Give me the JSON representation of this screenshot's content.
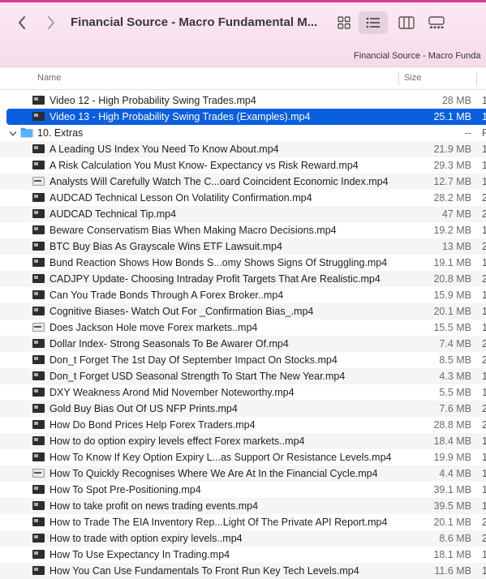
{
  "window": {
    "title": "Financial Source - Macro Fundamental M...",
    "path": "Financial Source - Macro Funda"
  },
  "columns": {
    "name": "Name",
    "size": "Size"
  },
  "top_rows": [
    {
      "name": "Video 12 - High Probability Swing Trades.mp4",
      "size": "28 MB",
      "extra": "1",
      "icon": "video-thumbnail-icon"
    },
    {
      "name": "Video 13 - High Probability Swing Trades (Examples).mp4",
      "size": "25.1 MB",
      "extra": "1",
      "icon": "video-thumbnail-icon",
      "selected": true
    }
  ],
  "folder": {
    "name": "10. Extras",
    "size": "--",
    "extra": "F"
  },
  "files": [
    {
      "name": "A Leading US Index You Need To Know About.mp4",
      "size": "21.9 MB",
      "extra": "1"
    },
    {
      "name": "A Risk Calculation You Must Know- Expectancy vs Risk Reward.mp4",
      "size": "29.3 MB",
      "extra": "1"
    },
    {
      "name": "Analysts Will Carefully Watch The C...oard Coincident Economic Index.mp4",
      "size": "12.7 MB",
      "extra": "1",
      "light": true
    },
    {
      "name": "AUDCAD Technical Lesson On Volatility Confirmation.mp4",
      "size": "28.2 MB",
      "extra": "2"
    },
    {
      "name": "AUDCAD Technical Tip.mp4",
      "size": "47 MB",
      "extra": "2"
    },
    {
      "name": "Beware Conservatism Bias When Making Macro Decisions.mp4",
      "size": "19.2 MB",
      "extra": "1"
    },
    {
      "name": "BTC Buy Bias As Grayscale Wins ETF Lawsuit.mp4",
      "size": "13 MB",
      "extra": "2"
    },
    {
      "name": "Bund Reaction Shows How Bonds S...omy Shows Signs Of Struggling.mp4",
      "size": "19.1 MB",
      "extra": "1"
    },
    {
      "name": "CADJPY Update- Choosing Intraday Profit Targets That Are Realistic.mp4",
      "size": "20.8 MB",
      "extra": "2"
    },
    {
      "name": "Can You Trade Bonds Through A Forex Broker..mp4",
      "size": "15.9 MB",
      "extra": "1"
    },
    {
      "name": "Cognitive Biases- Watch Out For _Confirmation Bias_.mp4",
      "size": "20.1 MB",
      "extra": "1"
    },
    {
      "name": "Does Jackson Hole move Forex markets..mp4",
      "size": "15.5 MB",
      "extra": "1",
      "light": true
    },
    {
      "name": "Dollar Index- Strong Seasonals To Be Awarer Of.mp4",
      "size": "7.4 MB",
      "extra": "2"
    },
    {
      "name": "Don_t Forget The 1st Day Of September Impact On Stocks.mp4",
      "size": "8.5 MB",
      "extra": "2"
    },
    {
      "name": "Don_t Forget USD Seasonal Strength To Start The New Year.mp4",
      "size": "4.3 MB",
      "extra": "1"
    },
    {
      "name": "DXY Weakness Arond Mid November Noteworthy.mp4",
      "size": "5.5 MB",
      "extra": "1"
    },
    {
      "name": "Gold Buy Bias Out Of US NFP Prints.mp4",
      "size": "7.6 MB",
      "extra": "2"
    },
    {
      "name": "How Do Bond Prices Help Forex Traders.mp4",
      "size": "28.8 MB",
      "extra": "2"
    },
    {
      "name": "How to do option expiry levels effect Forex markets..mp4",
      "size": "18.4 MB",
      "extra": "1"
    },
    {
      "name": "How To Know If Key Option Expiry L...as Support Or Resistance Levels.mp4",
      "size": "19.9 MB",
      "extra": "1"
    },
    {
      "name": "How To Quickly Recognises Where We Are At In the Financial Cycle.mp4",
      "size": "4.4 MB",
      "extra": "1",
      "light": true
    },
    {
      "name": "How To Spot Pre-Positioning.mp4",
      "size": "39.1 MB",
      "extra": "1"
    },
    {
      "name": "How to take profit on news trading events.mp4",
      "size": "39.5 MB",
      "extra": "1"
    },
    {
      "name": "How to Trade The EIA Inventory Rep...Light Of The Private API Report.mp4",
      "size": "20.1 MB",
      "extra": "2"
    },
    {
      "name": "How to trade with option expiry levels..mp4",
      "size": "8.6 MB",
      "extra": "2"
    },
    {
      "name": "How To Use Expectancy In Trading.mp4",
      "size": "18.1 MB",
      "extra": "1"
    },
    {
      "name": "How You Can Use Fundamentals To Front Run Key Tech Levels.mp4",
      "size": "11.6 MB",
      "extra": "1"
    }
  ]
}
